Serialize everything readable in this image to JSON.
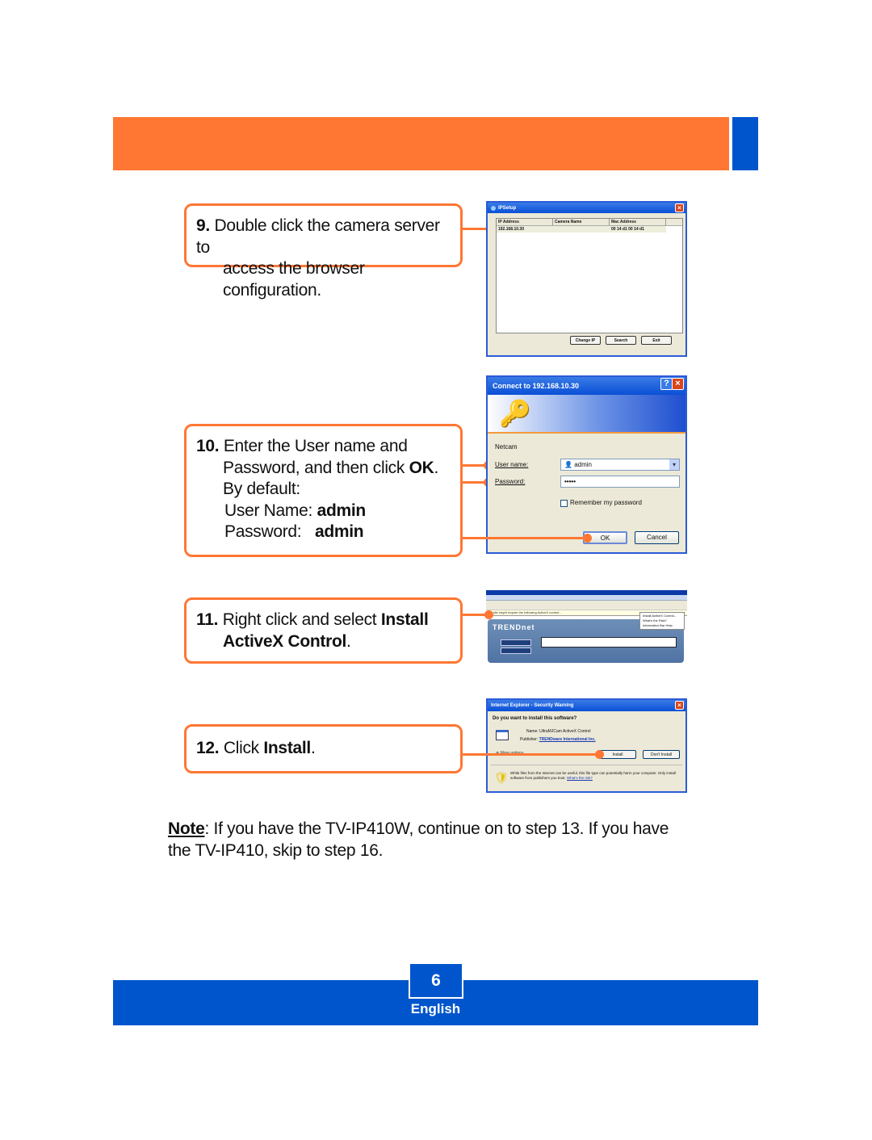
{
  "header": {
    "orange_color": "#ff7733",
    "blue_color": "#0055cc"
  },
  "steps": [
    {
      "number": "9.",
      "line1": "Double click the camera server to",
      "line2": "access the browser configuration."
    },
    {
      "number": "10.",
      "line1": "Enter the User name and",
      "line2_pre": "Password, and then click ",
      "line2_bold": "OK",
      "line2_post": ".",
      "line3": "By default:",
      "user_label": "User Name: ",
      "user_value": "admin",
      "pass_label": "Password:   ",
      "pass_value": "admin"
    },
    {
      "number": "11.",
      "line1_pre": "Right click and select ",
      "line1_bold": "Install",
      "line2_bold": "ActiveX Control",
      "line2_post": "."
    },
    {
      "number": "12.",
      "line1_pre": "Click ",
      "line1_bold": "Install",
      "line1_post": "."
    }
  ],
  "ipsetup": {
    "title": "IPSetup",
    "columns": [
      "IP Address",
      "Camera Name",
      "Mac Address"
    ],
    "rows": [
      {
        "ip": "192.168.10.30",
        "name": "",
        "mac": "00 14 d1 00 14 d1"
      }
    ],
    "buttons": [
      "Change IP",
      "Search",
      "Exit"
    ]
  },
  "connect_dialog": {
    "title": "Connect to 192.168.10.30",
    "realm": "Netcam",
    "user_label": "User name:",
    "user_value": "admin",
    "password_label": "Password:",
    "password_value": "•••••",
    "remember_label": "Remember my password",
    "ok_label": "OK",
    "cancel_label": "Cancel"
  },
  "activex_browser": {
    "infobar_text": "This site might require the following ActiveX control...",
    "logo": "TRENDnet",
    "context_menu": [
      "Install ActiveX Control...",
      "What's the Risk?",
      "Information Bar Help"
    ]
  },
  "security_warning": {
    "title": "Internet Explorer - Security Warning",
    "question": "Do you want to install this software?",
    "name_label": "Name:",
    "name_value": "UltraMJCam ActiveX Control",
    "publisher_label": "Publisher:",
    "publisher_value": "TRENDware International Inc.",
    "more_options": "More options",
    "install_label": "Install",
    "dont_install_label": "Don't Install",
    "warning_text": "While files from the Internet can be useful, this file type can potentially harm your computer. Only install software from publishers you trust.",
    "risk_link": "What's the risk?"
  },
  "note": {
    "label": "Note",
    "text": ": If you have the TV-IP410W, continue on to step 13.  If you have the TV-IP410, skip to step 16."
  },
  "footer": {
    "page_number": "6",
    "language": "English"
  }
}
